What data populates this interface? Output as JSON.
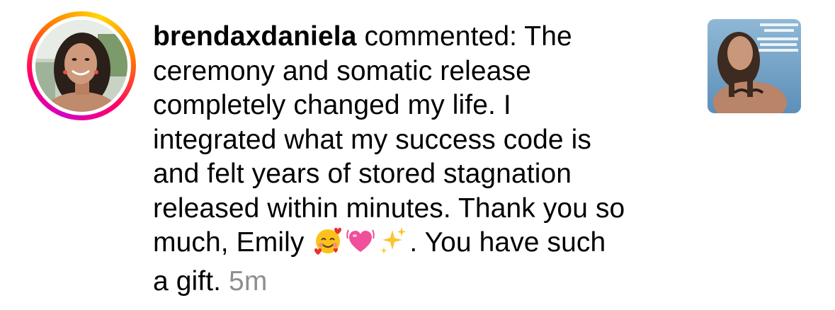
{
  "notification": {
    "username": "brendaxdaniela",
    "comment_lines": [
      " commented: The",
      "ceremony and somatic release",
      "completely changed my life. I",
      "integrated what my success code is",
      "and felt years of stored stagnation",
      "released within minutes. Thank you so",
      "much, Emily ",
      ". You have such",
      "a gift. "
    ],
    "timestamp": "5m",
    "emojis": [
      "smiling-face-with-hearts",
      "growing-heart",
      "sparkles"
    ],
    "colors": {
      "text": "#000000",
      "timestamp": "#8e8e8e",
      "story_ring": [
        "#d300c5",
        "#ff0069",
        "#ff7a00",
        "#ffd600"
      ]
    }
  }
}
